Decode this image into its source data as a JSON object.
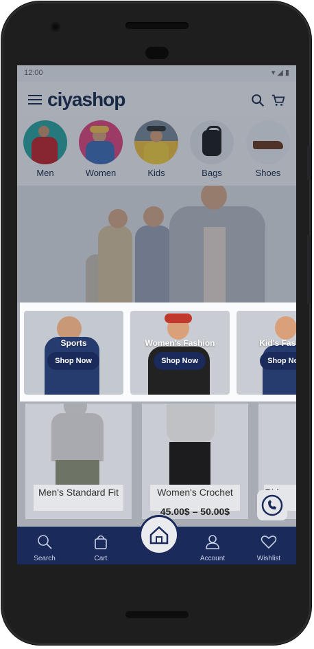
{
  "app": {
    "brand": "ciyashop"
  },
  "status_bar": {
    "time": "12:00",
    "right": "▾ ◢ ▮"
  },
  "categories": [
    {
      "label": "Men",
      "color": "#2aa5a0"
    },
    {
      "label": "Women",
      "color": "#e0457b"
    },
    {
      "label": "Kids",
      "color": "#f0c040"
    },
    {
      "label": "Bags",
      "color": "#e4e6ea"
    },
    {
      "label": "Shoes",
      "color": "#eceef1"
    }
  ],
  "popup": {
    "cards": [
      {
        "title": "Sports",
        "button": "Shop Now"
      },
      {
        "title": "Women's Fashion",
        "button": "Shop Now"
      },
      {
        "title": "Kid's Fashion",
        "button": "Shop Now"
      }
    ]
  },
  "products": [
    {
      "name": "Men's Standard Fit",
      "price": ""
    },
    {
      "name": "Women's Crochet",
      "price": "45.00$ – 50.00$"
    },
    {
      "name": "Girls",
      "price": ""
    }
  ],
  "nav": {
    "search": "Search",
    "cart": "Cart",
    "account": "Account",
    "wishlist": "Wishlist"
  },
  "colors": {
    "primary": "#1a2a5a",
    "overlay": "rgba(30,40,60,0.35)"
  }
}
